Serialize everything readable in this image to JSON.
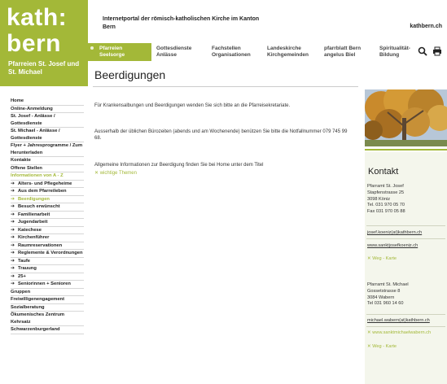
{
  "logo": {
    "line1": "kath:",
    "line2": "bern",
    "subtitle": "Pfarreien St. Josef und St. Michael"
  },
  "header": {
    "tagline": "Internetportal der römisch-katholischen Kirche im Kanton Bern",
    "site_url": "kathbern.ch"
  },
  "topnav": {
    "items": [
      {
        "line1": "Pfarreien",
        "line2": "Seelsorge"
      },
      {
        "line1": "Gottesdienste",
        "line2": "Anlässe"
      },
      {
        "line1": "Fachstellen",
        "line2": "Organisationen"
      },
      {
        "line1": "Landeskirche",
        "line2": "Kirchgemeinden"
      },
      {
        "line1": "pfarrblatt Bern",
        "line2": "angelus Biel"
      },
      {
        "line1": "Spiritualität-",
        "line2": "Bildung"
      }
    ],
    "icons": [
      "search-icon",
      "print-icon"
    ]
  },
  "page": {
    "title": "Beerdigungen"
  },
  "sidebar": {
    "items": [
      {
        "label": "Home"
      },
      {
        "label": "Online-Anmeldung"
      },
      {
        "label": "St. Josef - Anlässe / Gottesdienste"
      },
      {
        "label": "St. Michael - Anlässe / Gottesdienste"
      },
      {
        "label": "Flyer + Jahresprogramme / Zum Herunterladen"
      },
      {
        "label": "Kontakte"
      },
      {
        "label": "Offene Stellen"
      },
      {
        "label": "Informationen von A - Z"
      },
      {
        "label": "Alters- und Pflegeheime"
      },
      {
        "label": "Aus dem Pfarreileben"
      },
      {
        "label": "Beerdigungen"
      },
      {
        "label": "Besuch erwünscht"
      },
      {
        "label": "Familienarbeit"
      },
      {
        "label": "Jugendarbeit"
      },
      {
        "label": "Katechese"
      },
      {
        "label": "Kirchenführer"
      },
      {
        "label": "Raumreservationen"
      },
      {
        "label": "Reglemente & Verordnungen"
      },
      {
        "label": "Taufe"
      },
      {
        "label": "Trauung"
      },
      {
        "label": "25+"
      },
      {
        "label": "Seniorinnen + Senioren"
      },
      {
        "label": "Gruppen"
      },
      {
        "label": "Freiwilligenengagement"
      },
      {
        "label": "Sozialberatung"
      },
      {
        "label": "Ökumenisches Zentrum Kehrsatz"
      },
      {
        "label": "Schwarzenburgerland"
      }
    ]
  },
  "content": {
    "p1": "Für Krankensalbungen und Beerdigungen wenden Sie sich bitte an die Pfarreisekretariate.",
    "p2": "Ausserhalb der üblichen Bürozeiten (abends und am Wochenende) benützen Sie bitte die Notfallnummer 079 745 99 68.",
    "p3": "Allgemeine Informationen zur Beerdigung finden Sie bei Home unter dem Titel",
    "p3_link": "wichtige Themen"
  },
  "kontakt": {
    "title": "Kontakt",
    "josef": {
      "name": "Pfarramt St. Josef",
      "street": "Stapfenstrasse 25",
      "city": "3098 Köniz",
      "tel": "Tel. 031 970 05 70",
      "fax": "Fax 031 970 05 88",
      "email": "josef.koeniz(at)kathbern.ch",
      "web": "www.sanktjosefkoeniz.ch",
      "map": "Weg - Karte"
    },
    "michael": {
      "name": "Pfarramt St. Michael",
      "street": "Gossetstrasse 8",
      "city": "3084 Wabern",
      "tel": "Tel 031 960 14 60",
      "email": "michael.wabern(at)kathbern.ch",
      "web": "www.sanktmichaelwabern.ch",
      "map": "Weg - Karte"
    }
  },
  "colors": {
    "brand_green": "#a3b838"
  }
}
